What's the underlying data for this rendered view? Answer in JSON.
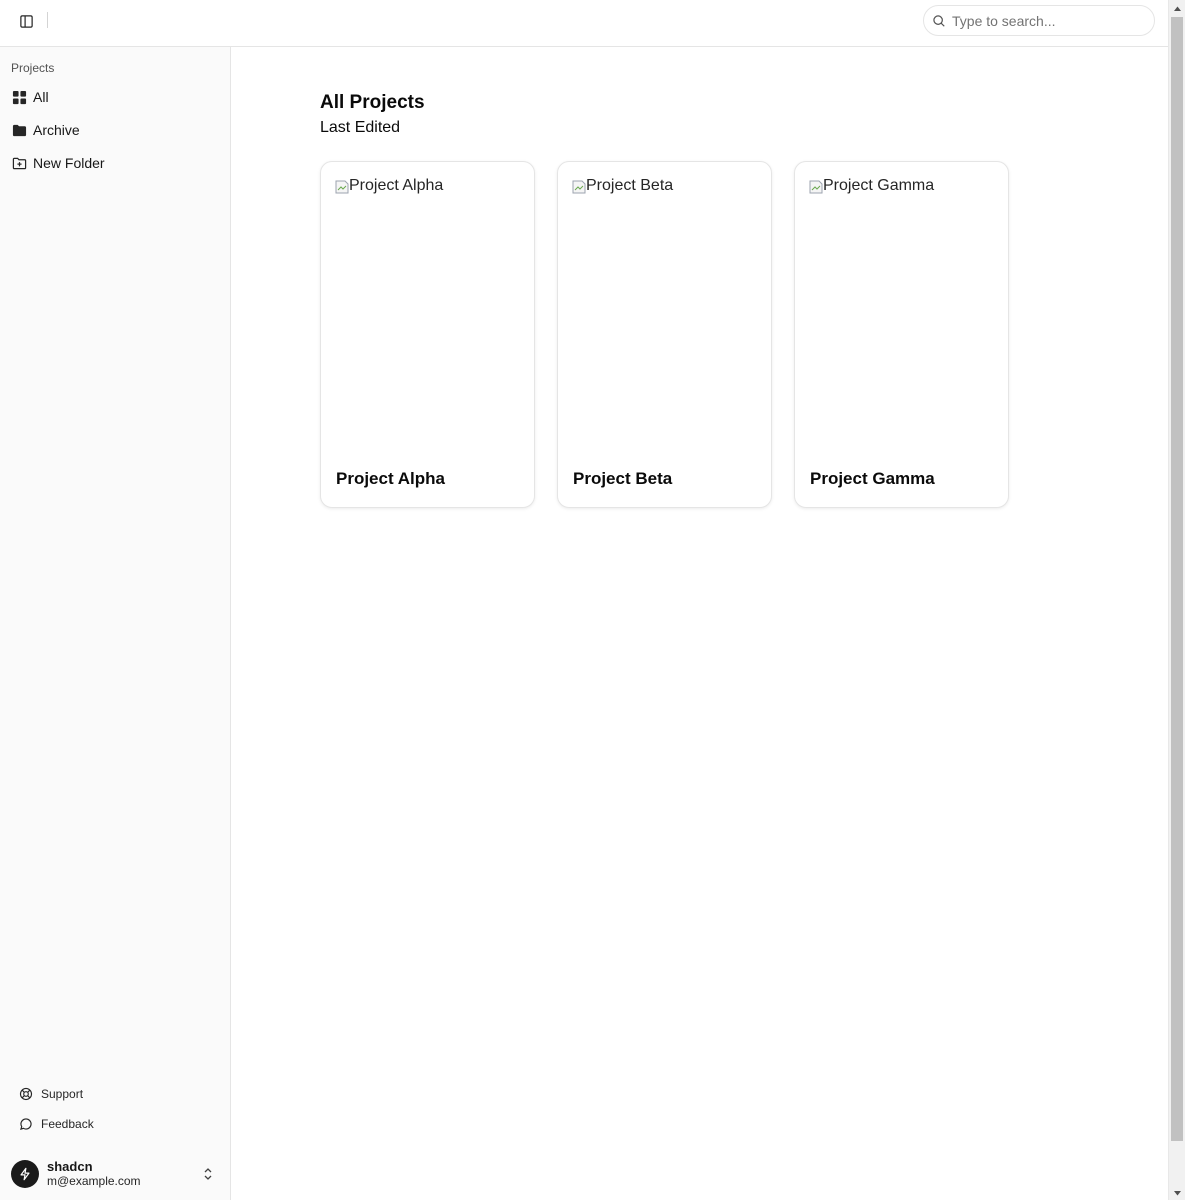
{
  "sidebar": {
    "group_label": "Projects",
    "items": [
      {
        "label": "All",
        "icon": "grid-icon"
      },
      {
        "label": "Archive",
        "icon": "folder-icon"
      },
      {
        "label": "New Folder",
        "icon": "folder-plus-icon"
      }
    ],
    "footer_links": [
      {
        "label": "Support",
        "icon": "life-buoy-icon"
      },
      {
        "label": "Feedback",
        "icon": "message-circle-icon"
      }
    ],
    "user": {
      "name": "shadcn",
      "email": "m@example.com"
    }
  },
  "header": {
    "search_placeholder": "Type to search..."
  },
  "main": {
    "title": "All Projects",
    "subtitle": "Last Edited",
    "projects": [
      {
        "image_alt": "Project Alpha",
        "title": "Project Alpha"
      },
      {
        "image_alt": "Project Beta",
        "title": "Project Beta"
      },
      {
        "image_alt": "Project Gamma",
        "title": "Project Gamma"
      }
    ]
  }
}
